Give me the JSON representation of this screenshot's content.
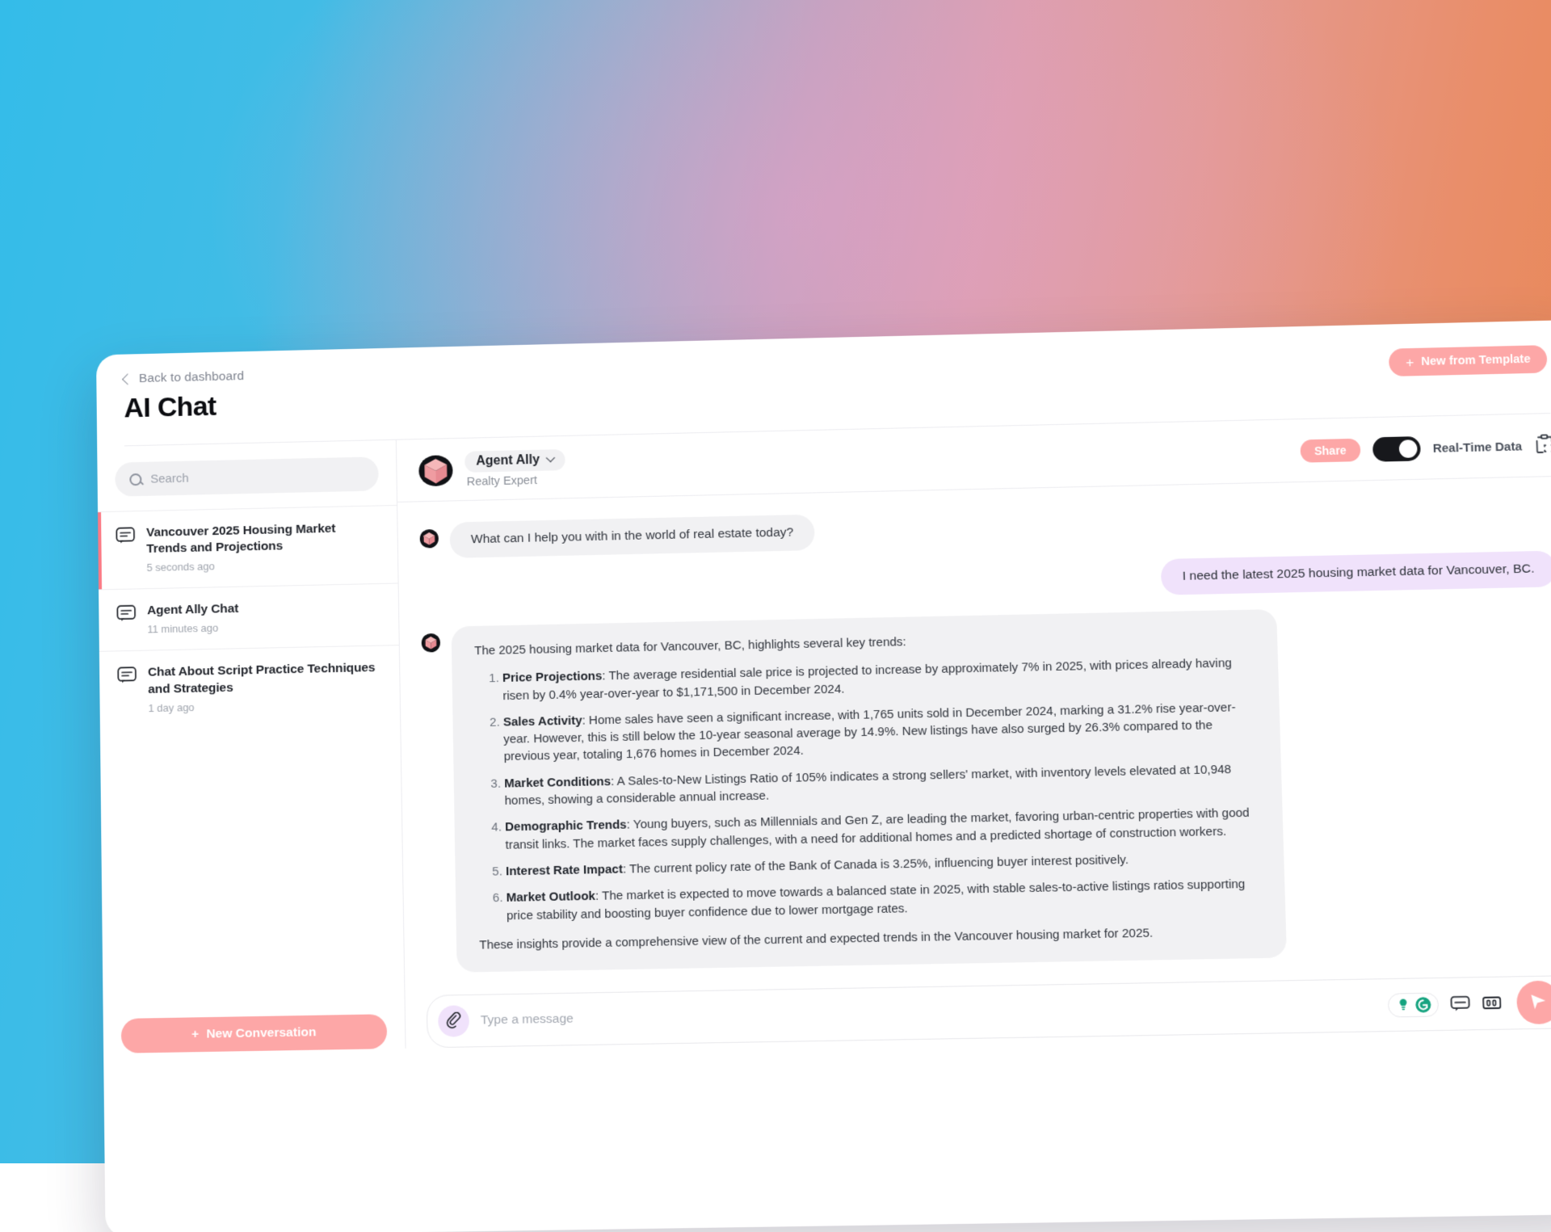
{
  "header": {
    "back_label": "Back to dashboard",
    "title": "AI Chat",
    "template_button": "New from Template",
    "plus": "+"
  },
  "sidebar": {
    "search_placeholder": "Search",
    "search_value": "",
    "new_conversation_label": "New Conversation",
    "new_conversation_plus": "+",
    "conversations": [
      {
        "title": "Vancouver 2025 Housing Market Trends and Projections",
        "time": "5 seconds ago",
        "active": true
      },
      {
        "title": "Agent Ally Chat",
        "time": "11 minutes ago",
        "active": false
      },
      {
        "title": "Chat About Script Practice Techniques and Strategies",
        "time": "1 day ago",
        "active": false
      }
    ]
  },
  "chat_header": {
    "agent_name": "Agent Ally",
    "agent_role": "Realty Expert",
    "share_label": "Share",
    "realtime_label": "Real-Time Data",
    "realtime_on": true
  },
  "messages": {
    "greeting": "What can I help you with in the world of real estate today?",
    "user_request": "I need the latest 2025 housing market data for Vancouver, BC.",
    "answer_intro": "The 2025 housing market data for Vancouver, BC, highlights several key trends:",
    "answer_items": [
      {
        "label": "Price Projections",
        "text": ": The average residential sale price is projected to increase by approximately 7% in 2025, with prices already having risen by 0.4% year-over-year to $1,171,500 in December 2024."
      },
      {
        "label": "Sales Activity",
        "text": ": Home sales have seen a significant increase, with 1,765 units sold in December 2024, marking a 31.2% rise year-over-year. However, this is still below the 10-year seasonal average by 14.9%. New listings have also surged by 26.3% compared to the previous year, totaling 1,676 homes in December 2024."
      },
      {
        "label": "Market Conditions",
        "text": ": A Sales-to-New Listings Ratio of 105% indicates a strong sellers' market, with inventory levels elevated at 10,948 homes, showing a considerable annual increase."
      },
      {
        "label": "Demographic Trends",
        "text": ": Young buyers, such as Millennials and Gen Z, are leading the market, favoring urban-centric properties with good transit links. The market faces supply challenges, with a need for additional homes and a predicted shortage of construction workers."
      },
      {
        "label": "Interest Rate Impact",
        "text": ": The current policy rate of the Bank of Canada is 3.25%, influencing buyer interest positively."
      },
      {
        "label": "Market Outlook",
        "text": ": The market is expected to move towards a balanced state in 2025, with stable sales-to-active listings ratios supporting price stability and boosting buyer confidence due to lower mortgage rates."
      }
    ],
    "answer_outro": "These insights provide a comprehensive view of the current and expected trends in the Vancouver housing market for 2025."
  },
  "composer": {
    "placeholder": "Type a message",
    "value": ""
  },
  "colors": {
    "accent_pink": "#fda7a7",
    "user_bubble": "#f0e2fb",
    "ai_bubble": "#f1f1f3",
    "active_marker": "#fb7a85",
    "toggle_on": "#17181c",
    "grammarly_green": "#15a37f"
  }
}
